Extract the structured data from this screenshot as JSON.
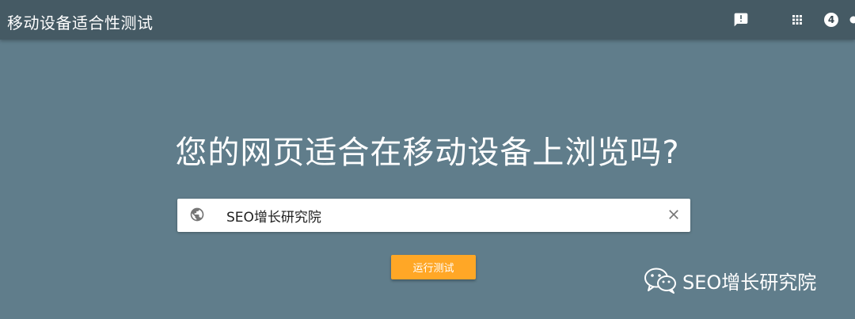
{
  "header": {
    "title": "移动设备适合性测试",
    "notification_count": "4",
    "icons": [
      "feedback-icon",
      "apps-grid-icon",
      "notification-badge"
    ]
  },
  "main": {
    "headline": "您的网页适合在移动设备上浏览吗?",
    "url_input": {
      "value": "SEO增长研究院",
      "placeholder": ""
    },
    "run_button_label": "运行测试"
  },
  "watermark": {
    "text": "SEO增长研究院"
  },
  "colors": {
    "background": "#607d8b",
    "topbar": "#455a64",
    "button": "#ffa726",
    "text": "#ffffff"
  }
}
